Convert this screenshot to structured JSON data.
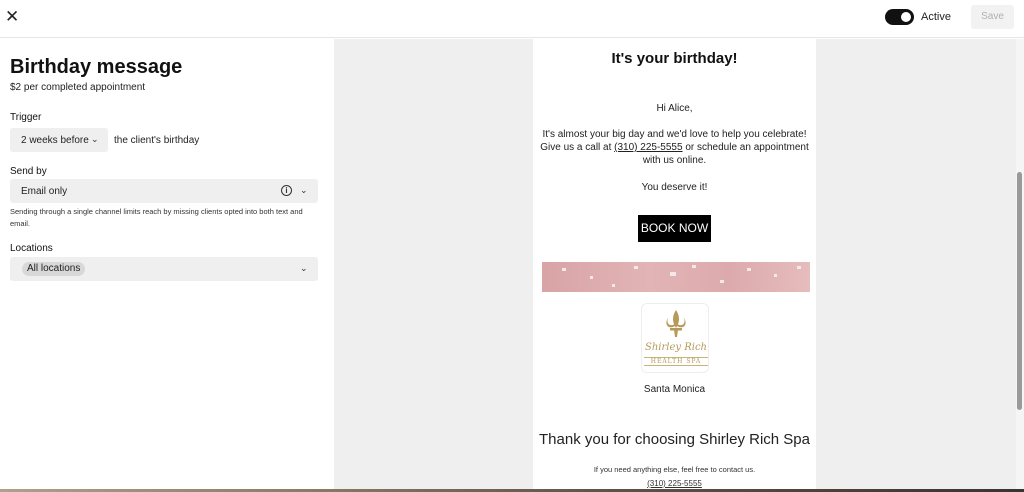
{
  "header": {
    "close_icon": "close-icon",
    "active_label": "Active",
    "active_on": true,
    "save_label": "Save"
  },
  "form": {
    "title": "Birthday message",
    "subtitle": "$2 per completed appointment",
    "trigger": {
      "label": "Trigger",
      "selected": "2 weeks before",
      "suffix": "the client's birthday"
    },
    "send_by": {
      "label": "Send by",
      "selected": "Email only",
      "helper": "Sending through a single channel limits reach by missing clients opted into both text and email."
    },
    "locations": {
      "label": "Locations",
      "selected": "All locations"
    }
  },
  "email": {
    "heading": "It's your birthday!",
    "greeting": "Hi Alice,",
    "body_before": "It's almost your big day and we'd love to help you celebrate! Give us a call at ",
    "phone": "(310) 225-5555",
    "body_after": " or schedule an appointment with us online.",
    "closing": "You deserve it!",
    "button": "BOOK NOW",
    "logo_script": "Shirley Rich",
    "logo_sub": "HEALTH SPA",
    "location": "Santa Monica",
    "thanks": "Thank you for choosing Shirley Rich Spa",
    "contact": "If you need anything else, feel free to contact us.",
    "contact_phone": "(310) 225-5555"
  }
}
